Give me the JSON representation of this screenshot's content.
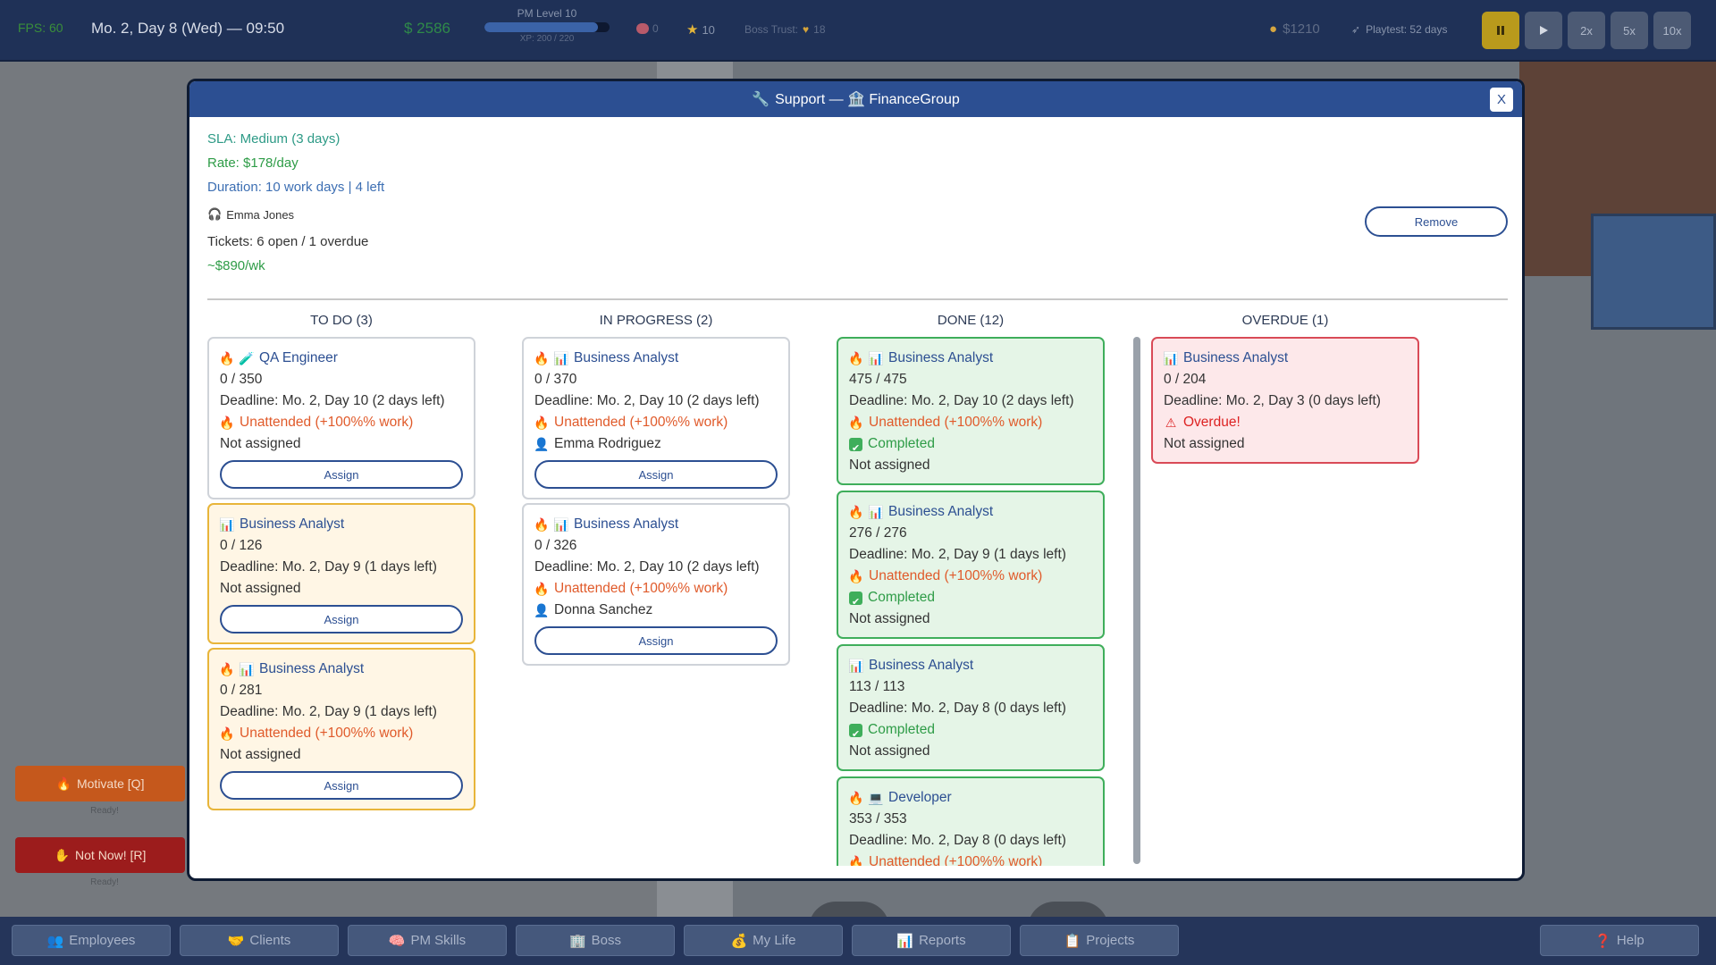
{
  "hud": {
    "fps": "FPS: 60",
    "date": "Mo. 2, Day 8 (Wed) — 09:50",
    "money": "$ 2586",
    "pm_level": "PM Level 10",
    "xp": "XP: 200 / 220",
    "xp_progress": 0.91,
    "brain": "0",
    "stars": "10",
    "boss_trust_label": "Boss Trust:",
    "boss_trust": "18",
    "bank": "$1210",
    "playtest": "Playtest: 52 days",
    "speed_buttons": [
      "2x",
      "5x",
      "10x"
    ]
  },
  "side": {
    "motivate": "Motivate [Q]",
    "motivate_status": "Ready!",
    "notnow": "Not Now! [R]",
    "notnow_status": "Ready!"
  },
  "nav": {
    "employees": "Employees",
    "clients": "Clients",
    "pm_skills": "PM Skills",
    "boss": "Boss",
    "my_life": "My Life",
    "reports": "Reports",
    "projects": "Projects",
    "help": "Help"
  },
  "modal": {
    "title": "Support — 🏦 FinanceGroup",
    "close": "X",
    "sla": "SLA: Medium (3 days)",
    "rate": "Rate: $178/day",
    "duration": "Duration: 10 work days | 4 left",
    "person": "Emma Jones",
    "tickets": "Tickets: 6 open / 1 overdue",
    "weekly": "~$890/wk",
    "remove": "Remove",
    "assign": "Assign"
  },
  "columns": {
    "todo": "TO DO (3)",
    "in_progress": "IN PROGRESS (2)",
    "done": "DONE (12)",
    "overdue": "OVERDUE (1)"
  },
  "todo": [
    {
      "role": "QA Engineer",
      "progress": "0 / 350",
      "deadline": "Deadline: Mo. 2, Day 10 (2 days left)",
      "unattended": "Unattended (+100%% work)",
      "assignee": "Not assigned"
    },
    {
      "role": "Business Analyst",
      "progress": "0 / 126",
      "deadline": "Deadline: Mo. 2, Day 9 (1 days left)",
      "assignee": "Not assigned"
    },
    {
      "role": "Business Analyst",
      "progress": "0 / 281",
      "deadline": "Deadline: Mo. 2, Day 9 (1 days left)",
      "unattended": "Unattended (+100%% work)",
      "assignee": "Not assigned"
    }
  ],
  "in_progress": [
    {
      "role": "Business Analyst",
      "progress": "0 / 370",
      "deadline": "Deadline: Mo. 2, Day 10 (2 days left)",
      "unattended": "Unattended (+100%% work)",
      "assignee": "Emma Rodriguez"
    },
    {
      "role": "Business Analyst",
      "progress": "0 / 326",
      "deadline": "Deadline: Mo. 2, Day 10 (2 days left)",
      "unattended": "Unattended (+100%% work)",
      "assignee": "Donna Sanchez"
    }
  ],
  "done": [
    {
      "role": "Business Analyst",
      "progress": "475 / 475",
      "deadline": "Deadline: Mo. 2, Day 10 (2 days left)",
      "unattended": "Unattended (+100%% work)",
      "status": "Completed",
      "assignee": "Not assigned"
    },
    {
      "role": "Business Analyst",
      "progress": "276 / 276",
      "deadline": "Deadline: Mo. 2, Day 9 (1 days left)",
      "unattended": "Unattended (+100%% work)",
      "status": "Completed",
      "assignee": "Not assigned"
    },
    {
      "role": "Business Analyst",
      "progress": "113 / 113",
      "deadline": "Deadline: Mo. 2, Day 8 (0 days left)",
      "status": "Completed",
      "assignee": "Not assigned"
    },
    {
      "role": "Developer",
      "progress": "353 / 353",
      "deadline": "Deadline: Mo. 2, Day 8 (0 days left)",
      "unattended": "Unattended (+100%% work)"
    }
  ],
  "overdue": [
    {
      "role": "Business Analyst",
      "progress": "0 / 204",
      "deadline": "Deadline: Mo. 2, Day 3 (0 days left)",
      "status": "Overdue!",
      "assignee": "Not assigned"
    }
  ]
}
